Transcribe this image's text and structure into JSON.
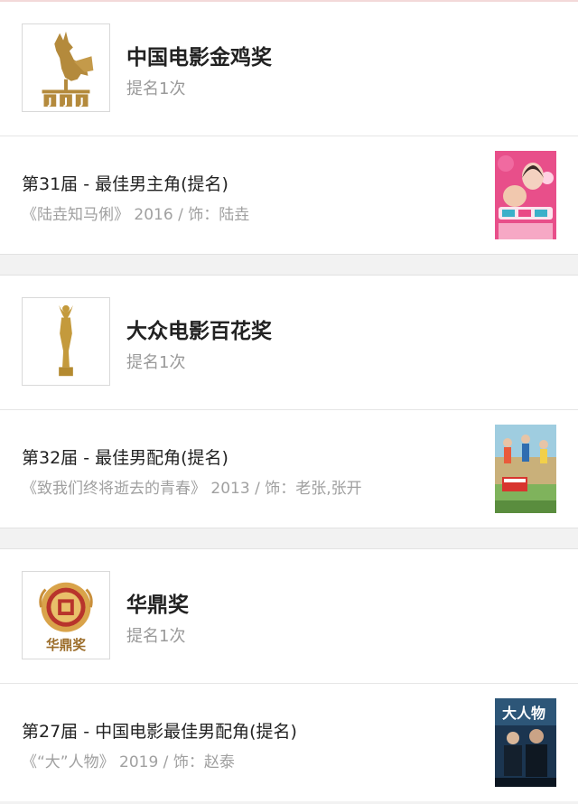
{
  "awards": [
    {
      "title": "中国电影金鸡奖",
      "count": "提名1次",
      "logo_icon": "golden-rooster-icon",
      "entry": {
        "title": "第31届 - 最佳男主角(提名)",
        "meta": "《陆垚知马俐》 2016 / 饰：陆垚"
      }
    },
    {
      "title": "大众电影百花奖",
      "count": "提名1次",
      "logo_icon": "hundred-flowers-statuette-icon",
      "entry": {
        "title": "第32届 - 最佳男配角(提名)",
        "meta": "《致我们终将逝去的青春》 2013 / 饰：老张,张开"
      }
    },
    {
      "title": "华鼎奖",
      "count": "提名1次",
      "logo_icon": "huading-emblem-icon",
      "logo_text": "华鼎奖",
      "entry": {
        "title": "第27届 - 中国电影最佳男配角(提名)",
        "meta": "《“大”人物》 2019 / 饰：赵泰"
      }
    }
  ]
}
